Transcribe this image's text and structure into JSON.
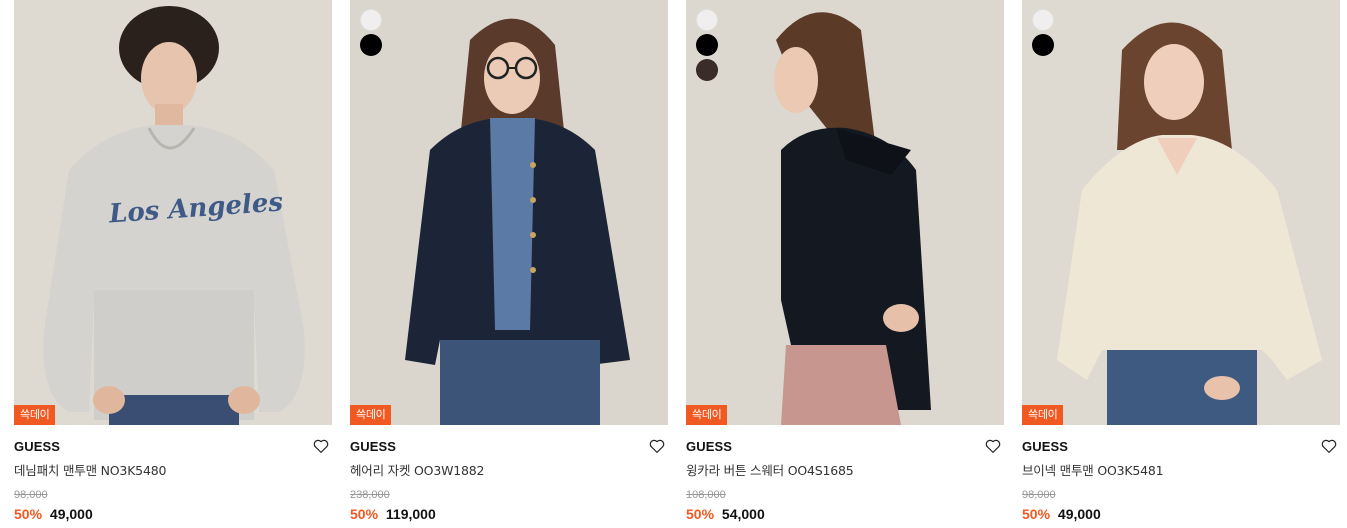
{
  "products": [
    {
      "brand": "GUESS",
      "name": "데님패치 맨투맨 NO3K5480",
      "badge": "쓱데이",
      "original_price": "98,000",
      "discount": "50%",
      "sale_price": "49,000",
      "swatches": [],
      "image_icon": "model-photo-grey-la-sweatshirt"
    },
    {
      "brand": "GUESS",
      "name": "헤어리 자켓 OO3W1882",
      "badge": "쓱데이",
      "original_price": "238,000",
      "discount": "50%",
      "sale_price": "119,000",
      "swatches": [
        "#f0eeee",
        "#000000"
      ],
      "image_icon": "model-photo-navy-jacket"
    },
    {
      "brand": "GUESS",
      "name": "윙카라 버튼 스웨터 OO4S1685",
      "badge": "쓱데이",
      "original_price": "108,000",
      "discount": "50%",
      "sale_price": "54,000",
      "swatches": [
        "#f0eeee",
        "#000000",
        "#3a2c28"
      ],
      "image_icon": "model-photo-black-knit"
    },
    {
      "brand": "GUESS",
      "name": "브이넥 맨투맨 OO3K5481",
      "badge": "쓱데이",
      "original_price": "98,000",
      "discount": "50%",
      "sale_price": "49,000",
      "swatches": [
        "#f0eeee",
        "#000000"
      ],
      "image_icon": "model-photo-cream-sweatshirt"
    }
  ],
  "colors": {
    "accent": "#f05a22",
    "photo_background": "#dcd8cf"
  },
  "icons": {
    "wishlist": "heart-outline-icon"
  }
}
